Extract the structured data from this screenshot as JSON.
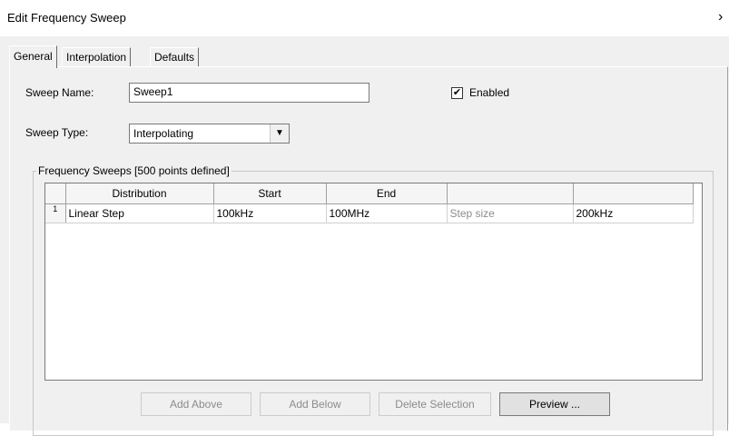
{
  "window": {
    "title": "Edit Frequency Sweep",
    "close_glyph": "›"
  },
  "tabs": [
    {
      "label": "General",
      "active": true
    },
    {
      "label": "Interpolation",
      "active": false
    },
    {
      "label": "Defaults",
      "active": false
    }
  ],
  "general": {
    "sweep_name_label": "Sweep Name:",
    "sweep_name_value": "Sweep1",
    "enabled_label": "Enabled",
    "enabled_checked": true,
    "enabled_check_glyph": "✔",
    "sweep_type_label": "Sweep Type:",
    "sweep_type_value": "Interpolating",
    "dropdown_glyph": "▼"
  },
  "frequency_sweeps": {
    "group_label": "Frequency Sweeps [500 points defined]",
    "columns": [
      "Distribution",
      "Start",
      "End",
      "",
      ""
    ],
    "rows": [
      {
        "index": "1",
        "distribution": "Linear Step",
        "start": "100kHz",
        "end": "100MHz",
        "param_label": "Step size",
        "param_value": "200kHz"
      }
    ]
  },
  "buttons": {
    "add_above": "Add Above",
    "add_below": "Add Below",
    "delete_selection": "Delete Selection",
    "preview": "Preview ..."
  }
}
